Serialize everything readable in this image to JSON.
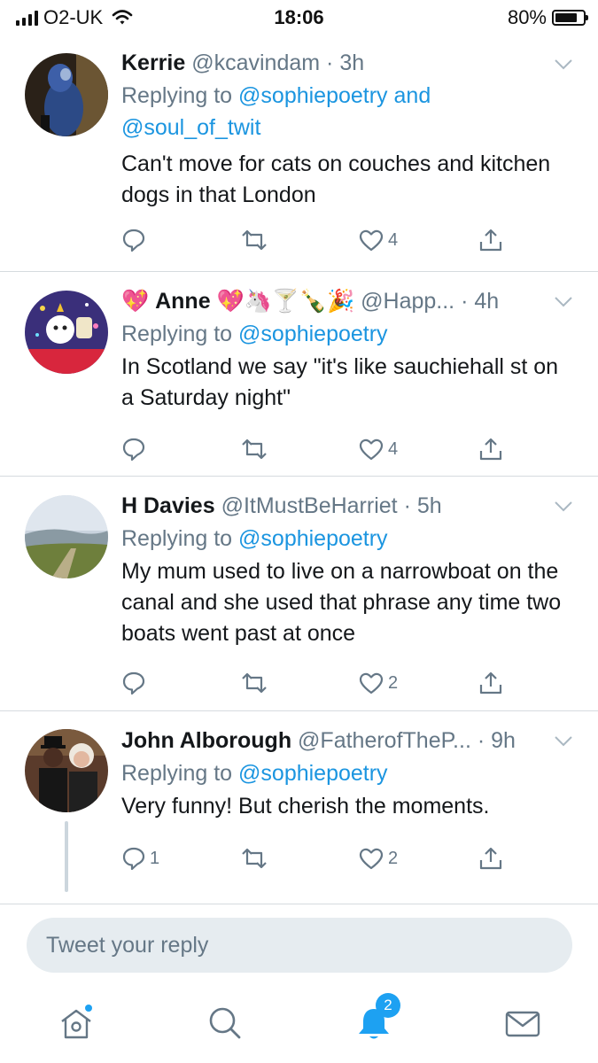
{
  "status_bar": {
    "carrier": "O2-UK",
    "time": "18:06",
    "battery_percent": "80%",
    "battery_level": 0.8
  },
  "tweets": [
    {
      "name": "Kerrie",
      "emoji_after_name": "",
      "handle": "@kcavindam",
      "time": "· 3h",
      "replying_prefix": "Replying to ",
      "replying_to_1": "@sophiepoetry",
      "replying_and": " and",
      "replying_to_2": "@soul_of_twit",
      "text": "Can't move for cats on couches and kitchen dogs in that London",
      "reply_count": "",
      "like_count": "4"
    },
    {
      "name": "Anne",
      "emoji_before_name": "💖",
      "emoji_after_name": "💖🦄🍸🍾🎉",
      "handle": "@Happ...",
      "time": "· 4h",
      "replying_prefix": "Replying to ",
      "replying_to_1": "@sophiepoetry",
      "text": "In Scotland we say \"it's like sauchiehall st on a Saturday night\"",
      "reply_count": "",
      "like_count": "4"
    },
    {
      "name": "H Davies",
      "handle": "@ItMustBeHarriet",
      "time": "· 5h",
      "replying_prefix": "Replying to ",
      "replying_to_1": "@sophiepoetry",
      "text": "My mum used to live on a narrowboat on the canal and she used that phrase any time two boats went past at once",
      "reply_count": "",
      "like_count": "2"
    },
    {
      "name": "John Alborough",
      "handle": "@FatherofTheP...",
      "time": "· 9h",
      "replying_prefix": "Replying to ",
      "replying_to_1": "@sophiepoetry",
      "text": "Very funny! But cherish the moments.",
      "reply_count": "1",
      "like_count": "2"
    }
  ],
  "composer": {
    "placeholder": "Tweet your reply"
  },
  "tab_bar": {
    "notifications_badge": "2",
    "items": [
      "home-icon",
      "search-icon",
      "notifications-icon",
      "messages-icon"
    ]
  },
  "colors": {
    "link": "#1b95e0",
    "secondary_text": "#657786",
    "badge": "#1da1f2",
    "divider": "#d6dbdf"
  }
}
